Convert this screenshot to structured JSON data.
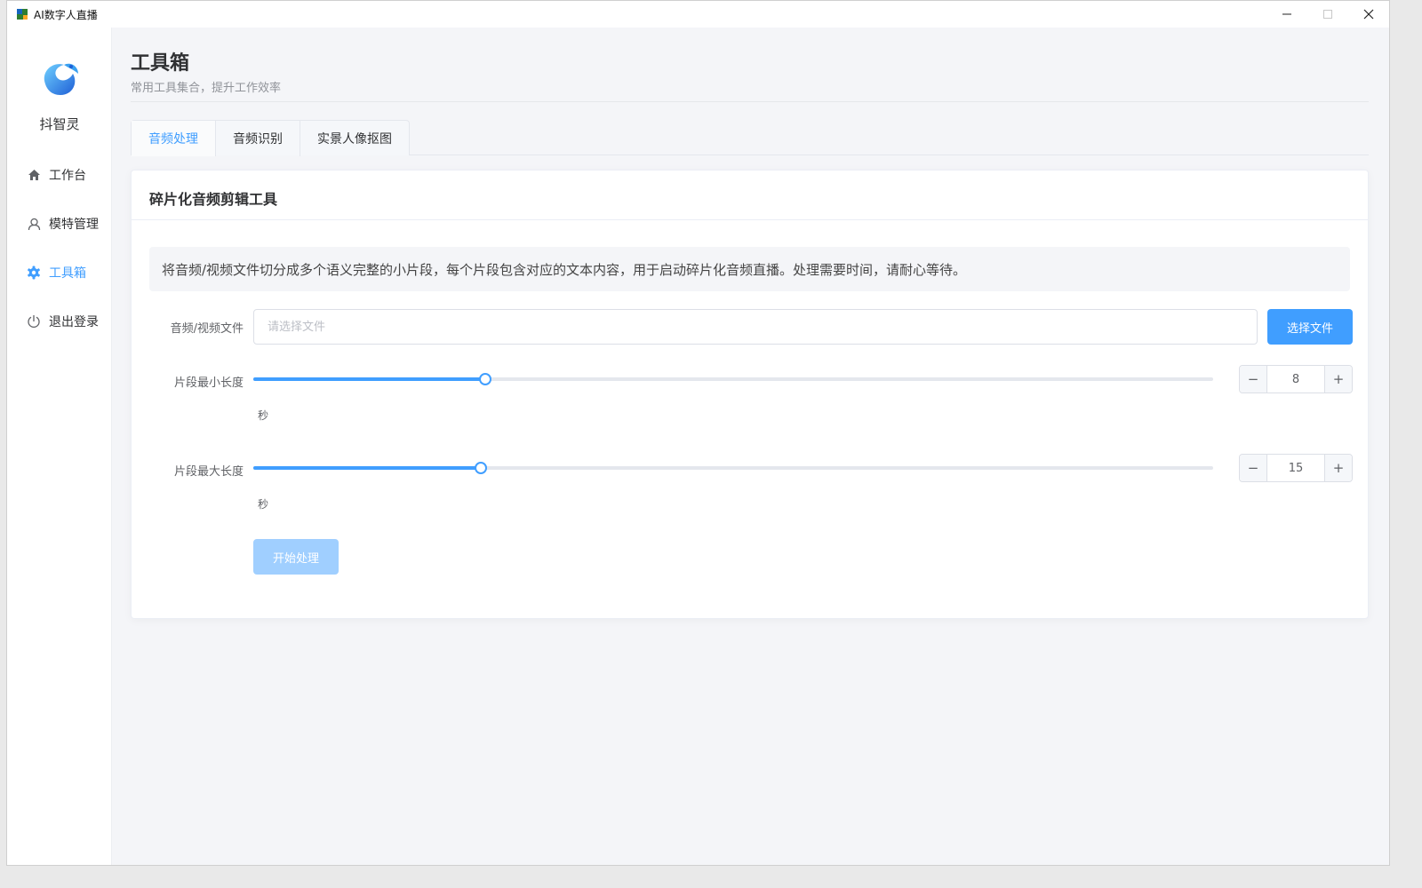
{
  "window": {
    "title": "AI数字人直播",
    "minimize_icon": "minimize-icon",
    "maximize_icon": "maximize-icon",
    "close_icon": "close-icon"
  },
  "sidebar": {
    "brand": "抖智灵",
    "items": [
      {
        "label": "工作台",
        "icon": "home-icon",
        "active": false
      },
      {
        "label": "模特管理",
        "icon": "user-icon",
        "active": false
      },
      {
        "label": "工具箱",
        "icon": "gear-icon",
        "active": true
      },
      {
        "label": "退出登录",
        "icon": "power-icon",
        "active": false
      }
    ]
  },
  "header": {
    "title": "工具箱",
    "subtitle": "常用工具集合，提升工作效率"
  },
  "tabs": [
    {
      "label": "音频处理",
      "active": true
    },
    {
      "label": "音频识别",
      "active": false
    },
    {
      "label": "实景人像抠图",
      "active": false
    }
  ],
  "card": {
    "title": "碎片化音频剪辑工具",
    "description": "将音频/视频文件切分成多个语义完整的小片段，每个片段包含对应的文本内容，用于启动碎片化音频直播。处理需要时间，请耐心等待。",
    "file": {
      "label": "音频/视频文件",
      "value": "",
      "placeholder": "请选择文件",
      "button": "选择文件"
    },
    "min_length": {
      "label": "片段最小长度",
      "value": "8",
      "fraction": 0.242,
      "unit": "秒",
      "minus": "−",
      "plus": "+"
    },
    "max_length": {
      "label": "片段最大长度",
      "value": "15",
      "fraction": 0.237,
      "unit": "秒",
      "minus": "−",
      "plus": "+"
    },
    "start_button": "开始处理"
  },
  "colors": {
    "accent": "#409eff",
    "accent_disabled": "#a0cfff",
    "background": "#f4f5f8"
  }
}
